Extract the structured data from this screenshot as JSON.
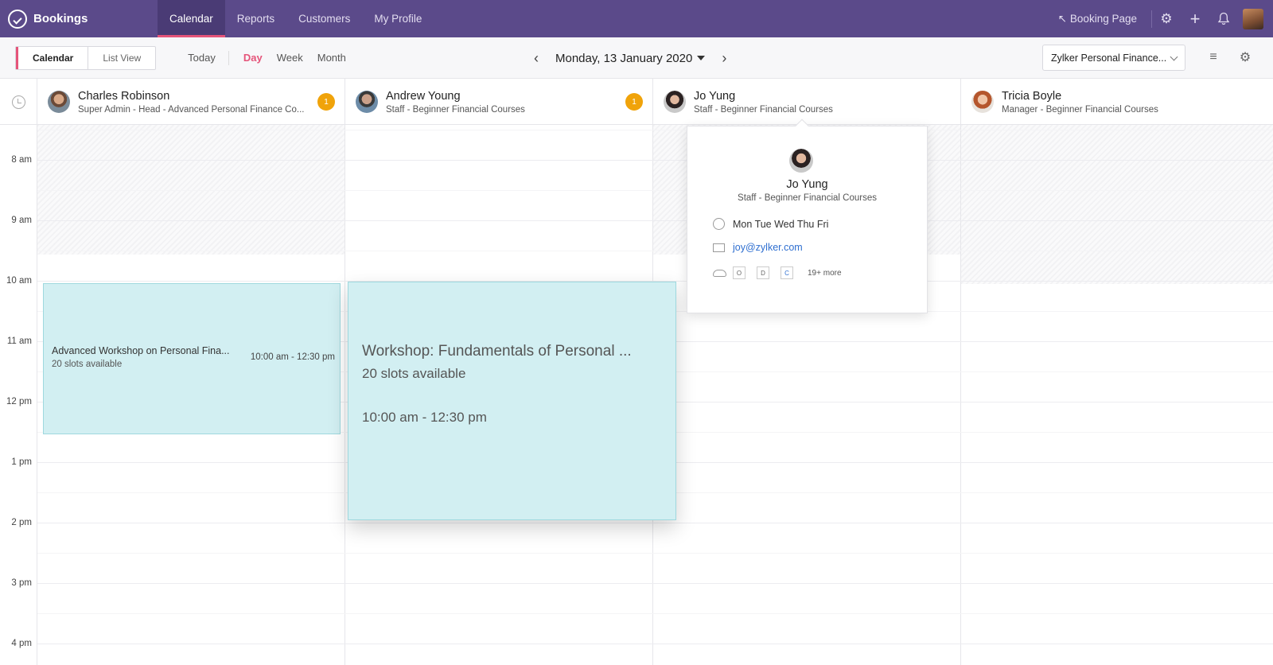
{
  "app": {
    "name": "Bookings"
  },
  "nav": {
    "tabs": [
      {
        "label": "Calendar",
        "active": true
      },
      {
        "label": "Reports",
        "active": false
      },
      {
        "label": "Customers",
        "active": false
      },
      {
        "label": "My Profile",
        "active": false
      }
    ],
    "booking_page": "Booking Page"
  },
  "toolbar": {
    "views": [
      "Calendar",
      "List View"
    ],
    "today": "Today",
    "ranges": [
      "Day",
      "Week",
      "Month"
    ],
    "date": "Monday, 13 January 2020",
    "workspace": "Zylker Personal Finance..."
  },
  "staff": [
    {
      "name": "Charles Robinson",
      "role": "Super Admin - Head - Advanced Personal Finance Co...",
      "badge": "1"
    },
    {
      "name": "Andrew Young",
      "role": "Staff - Beginner Financial Courses",
      "badge": "1"
    },
    {
      "name": "Jo Yung",
      "role": "Staff - Beginner Financial Courses"
    },
    {
      "name": "Tricia Boyle",
      "role": "Manager - Beginner Financial Courses"
    }
  ],
  "times": [
    "8 am",
    "9 am",
    "10 am",
    "11 am",
    "12 pm",
    "1 pm",
    "2 pm",
    "3 pm",
    "4 pm"
  ],
  "events": [
    {
      "title": "Advanced Workshop on Personal Fina...",
      "slots": "20 slots available",
      "time": "10:00 am - 12:30 pm"
    },
    {
      "title": "Workshop: Fundamentals of Personal ...",
      "slots": "20 slots available",
      "time": "10:00 am - 12:30 pm"
    }
  ],
  "popup": {
    "name": "Jo Yung",
    "role": "Staff - Beginner Financial Courses",
    "days": "Mon Tue Wed Thu Fri",
    "email": "joy@zylker.com",
    "chips": [
      "O",
      "D",
      "C"
    ],
    "more": "19+ more"
  },
  "colors": {
    "nav": "#5b4a8a",
    "accent": "#e5547a",
    "event": "#d2eff2",
    "badge": "#f0a30a"
  }
}
